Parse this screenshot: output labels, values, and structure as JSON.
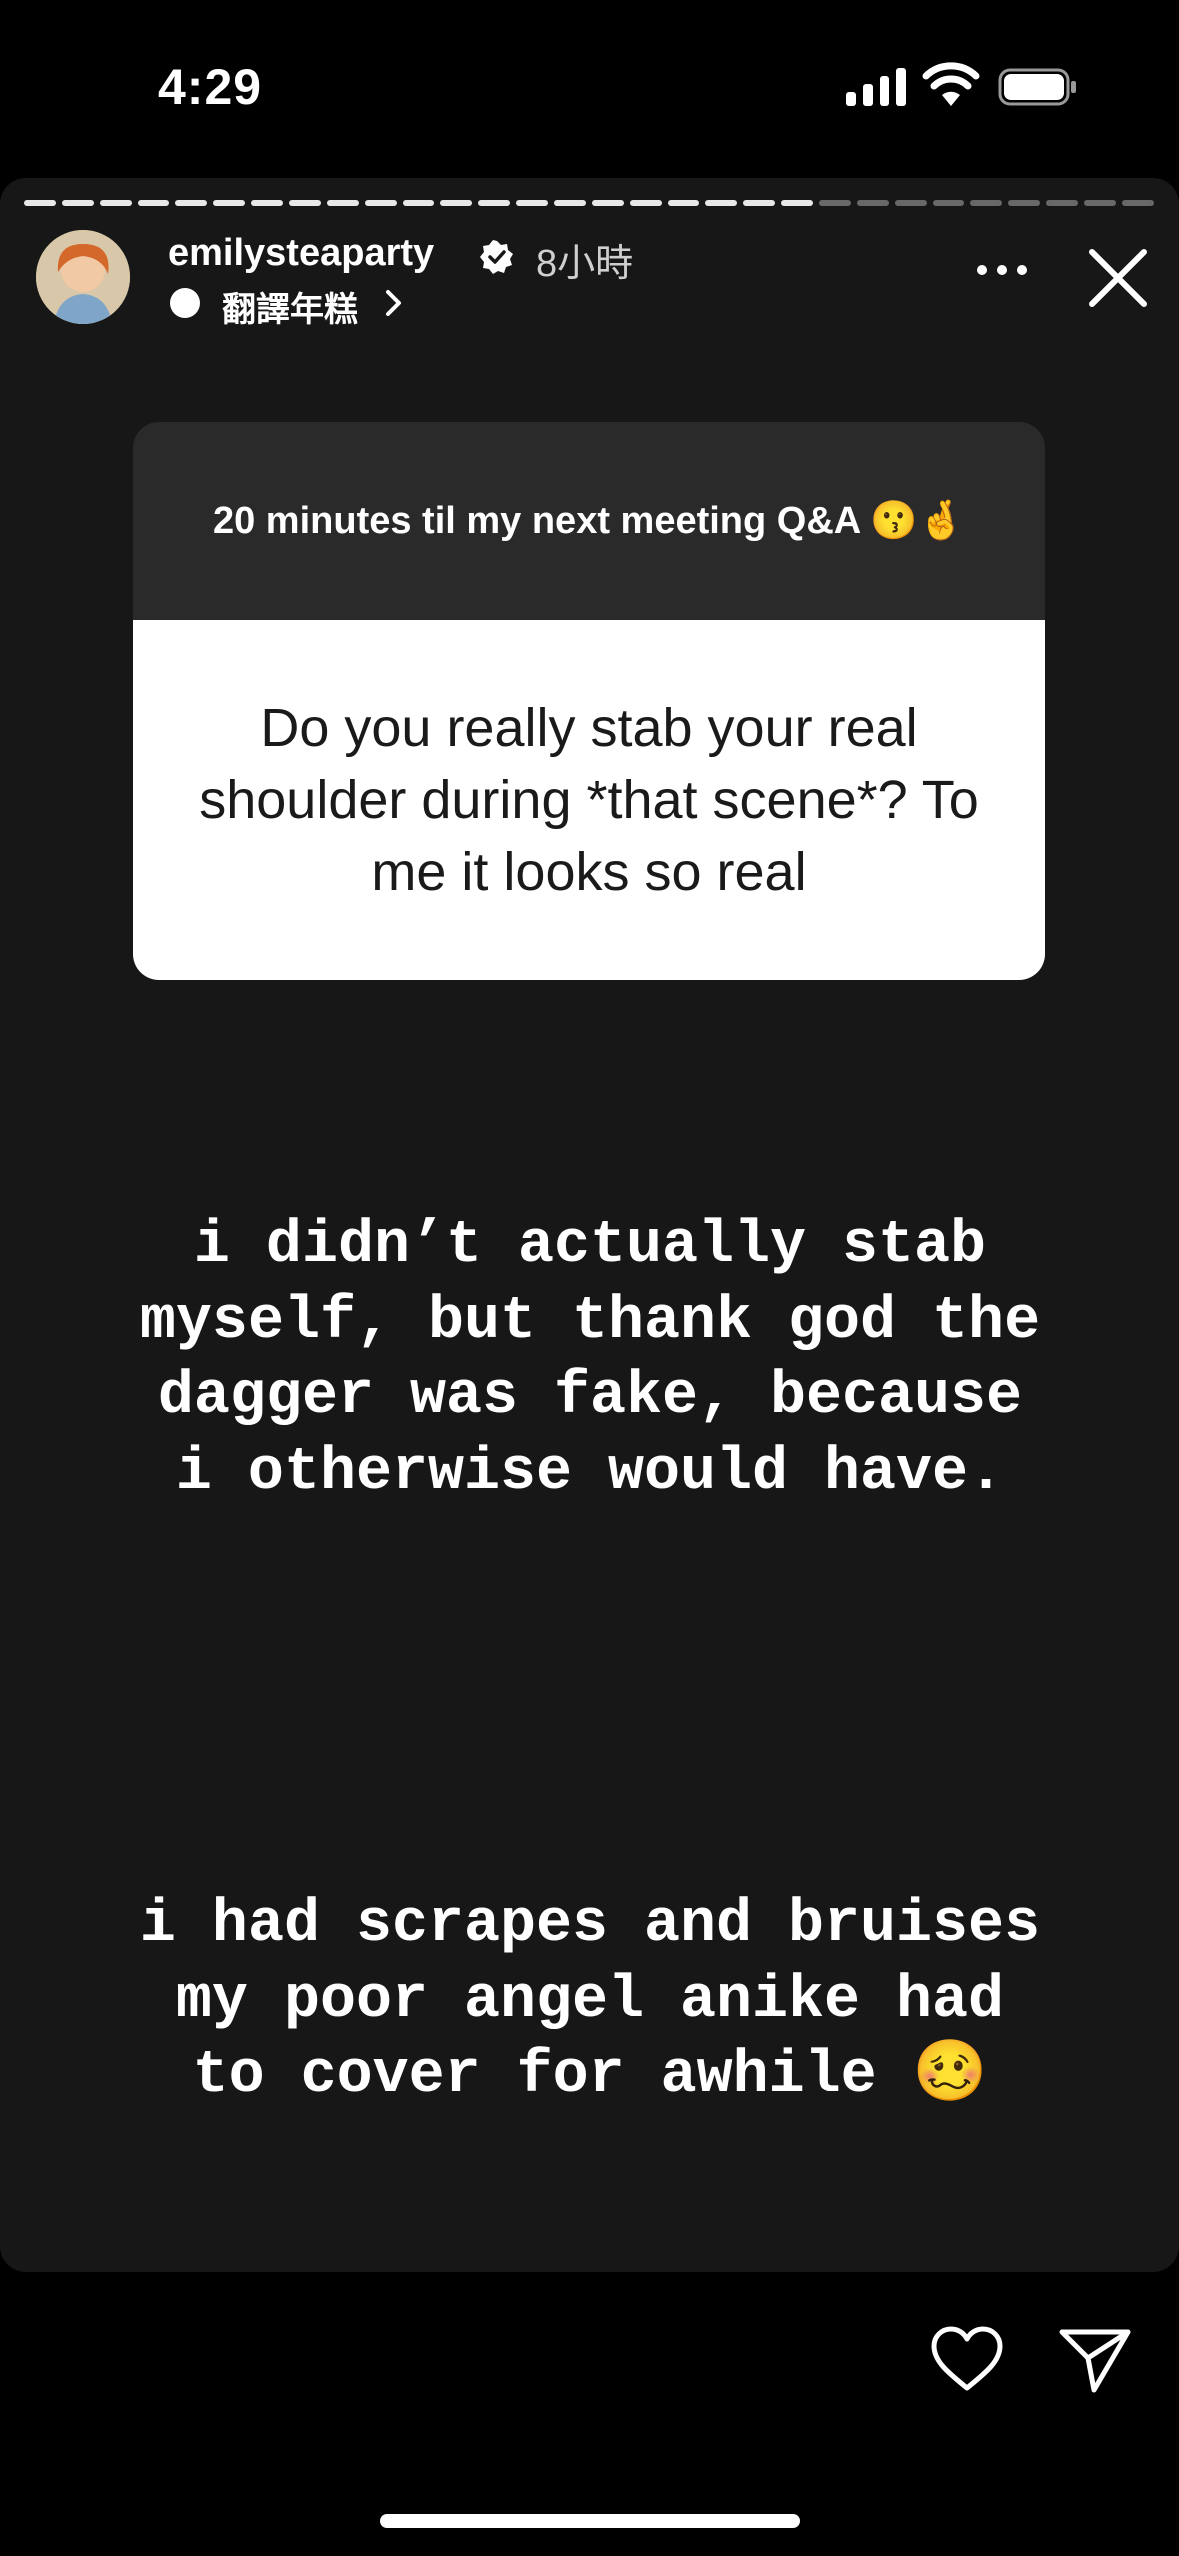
{
  "status_bar": {
    "time": "4:29",
    "signal_icon": "signal-bars-icon",
    "wifi_icon": "wifi-icon",
    "battery_icon": "battery-full-icon"
  },
  "story": {
    "progress_segments": 30,
    "progress_completed": 21,
    "username": "emilysteaparty",
    "verified_icon": "verified-badge-icon",
    "time_ago": "8小時",
    "music_label": "翻譯年糕",
    "more_icon": "more-horizontal-icon",
    "close_icon": "close-icon"
  },
  "question_card": {
    "prompt": "20 minutes til my next meeting Q&A 😗🤞",
    "question": "Do you really stab your real shoulder during *that scene*? To me it looks so real"
  },
  "answer": {
    "paragraph1": "i didn’t actually stab\nmyself, but thank god the\ndagger was fake, because\ni otherwise would have.",
    "paragraph2": "i had scrapes and bruises\nmy poor angel anike had\nto cover for awhile 🥴"
  },
  "actions": {
    "like_icon": "heart-icon",
    "send_icon": "send-icon"
  },
  "colors": {
    "background": "#000000",
    "story_background": "#171717",
    "card_header": "#2a2a2a",
    "card_body": "#ffffff"
  }
}
